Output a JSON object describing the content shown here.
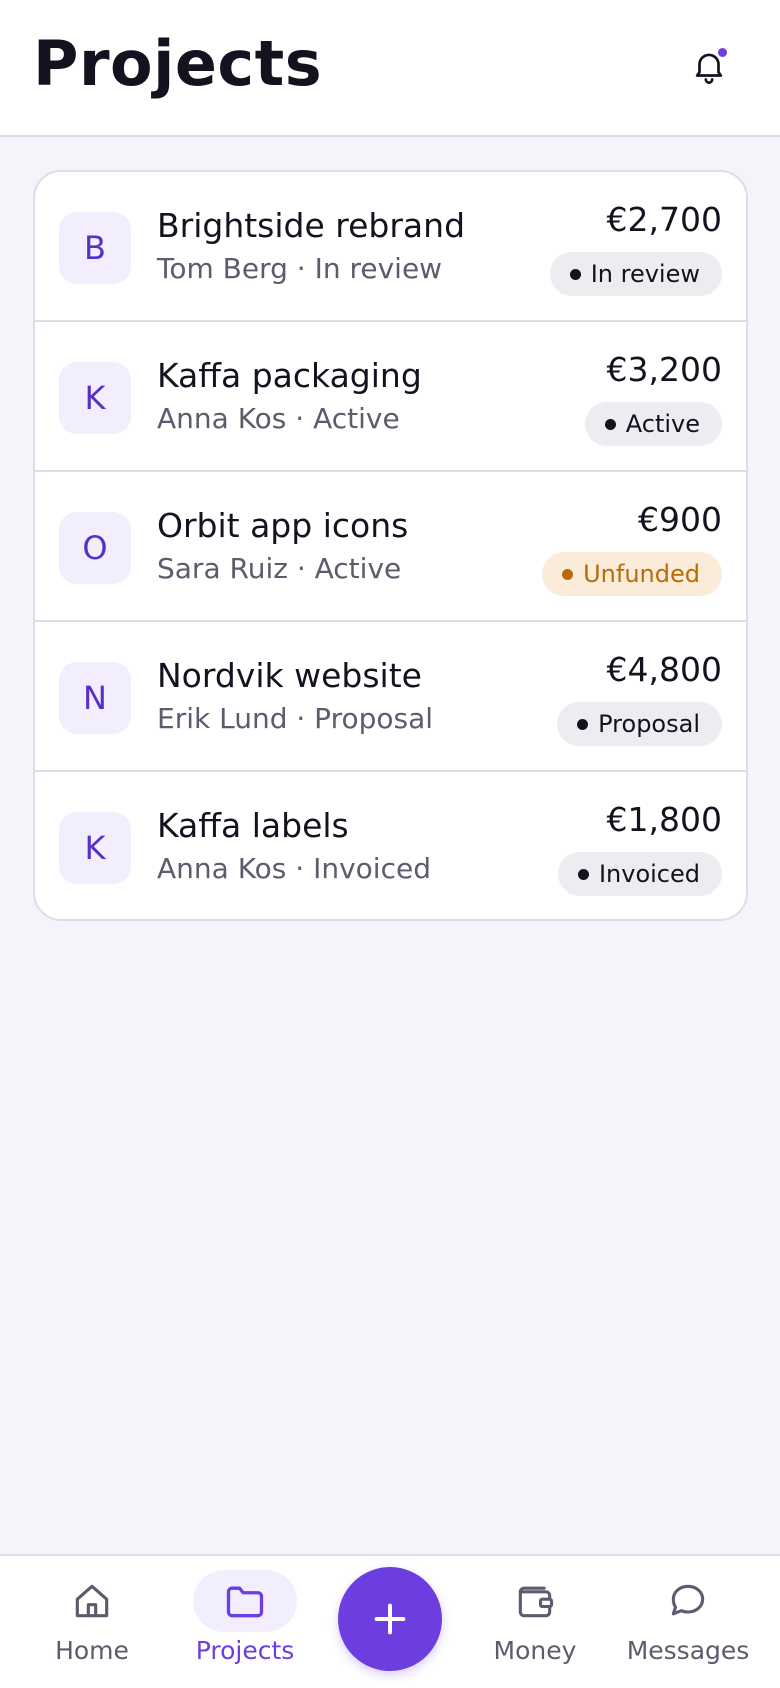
{
  "header": {
    "title": "Projects",
    "notification_icon": "bell-icon",
    "has_unread": true
  },
  "colors": {
    "accent": "#6c3ee0",
    "badge_neutral_bg": "#edecf1",
    "badge_warning_bg": "#faecd8",
    "badge_warning_text": "#b86b06"
  },
  "projects": [
    {
      "initial": "B",
      "name": "Brightside rebrand",
      "subtitle": "Tom Berg · In review",
      "amount": "€2,700",
      "status": "In review",
      "status_tone": "neutral"
    },
    {
      "initial": "K",
      "name": "Kaffa packaging",
      "subtitle": "Anna Kos · Active",
      "amount": "€3,200",
      "status": "Active",
      "status_tone": "neutral"
    },
    {
      "initial": "O",
      "name": "Orbit app icons",
      "subtitle": "Sara Ruiz · Active",
      "amount": "€900",
      "status": "Unfunded",
      "status_tone": "warning"
    },
    {
      "initial": "N",
      "name": "Nordvik website",
      "subtitle": "Erik Lund · Proposal",
      "amount": "€4,800",
      "status": "Proposal",
      "status_tone": "neutral"
    },
    {
      "initial": "K",
      "name": "Kaffa labels",
      "subtitle": "Anna Kos · Invoiced",
      "amount": "€1,800",
      "status": "Invoiced",
      "status_tone": "neutral"
    }
  ],
  "nav": {
    "items": [
      {
        "label": "Home",
        "icon": "home-icon",
        "active": false
      },
      {
        "label": "Projects",
        "icon": "folder-icon",
        "active": true
      },
      {
        "label": "Money",
        "icon": "wallet-icon",
        "active": false
      },
      {
        "label": "Messages",
        "icon": "chat-bubble-icon",
        "active": false
      }
    ],
    "fab_icon": "plus-icon"
  }
}
